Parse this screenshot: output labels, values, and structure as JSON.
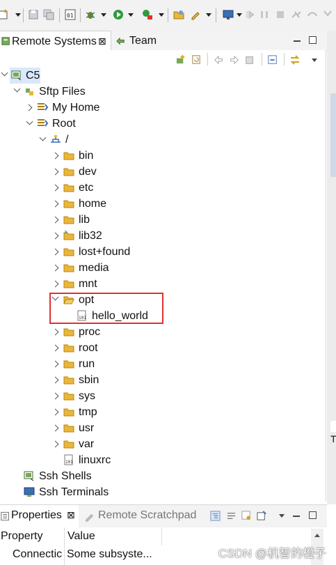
{
  "view_tabs": {
    "remote_systems": "Remote Systems",
    "close_glyph": "⊠",
    "team": "Team"
  },
  "tree": {
    "connection": "C5",
    "sftp": "Sftp Files",
    "my_home": "My Home",
    "root": "Root",
    "slash": "/",
    "folders_before": [
      "bin",
      "dev",
      "etc",
      "home",
      "lib",
      "lib32",
      "lost+found",
      "media",
      "mnt"
    ],
    "opt": "opt",
    "opt_child": "hello_world",
    "folders_after": [
      "proc",
      "root",
      "run",
      "sbin",
      "sys",
      "tmp",
      "usr",
      "var"
    ],
    "linuxrc": "linuxrc",
    "ssh_shells": "Ssh Shells",
    "ssh_terminals": "Ssh Terminals"
  },
  "right_strip_letter": "T",
  "properties": {
    "tab_properties": "Properties",
    "tab_scratchpad": "Remote Scratchpad",
    "col_property": "Property",
    "col_value": "Value",
    "row_property": "Connectic",
    "row_value": "Some subsyste..."
  },
  "watermark": "CSDN @机智的橙子",
  "colors": {
    "selection": "#d9e8fb",
    "highlight_box": "#e03030",
    "folder": "#e8b73c"
  }
}
